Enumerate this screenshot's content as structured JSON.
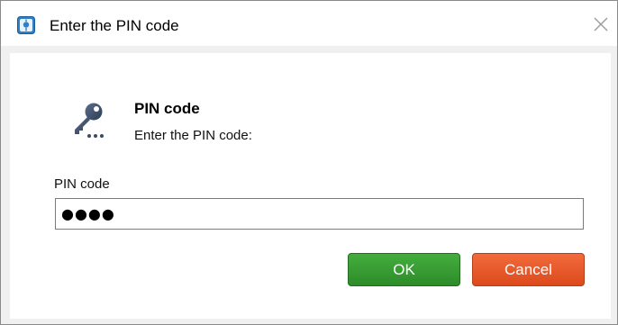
{
  "window": {
    "title": "Enter the PIN code",
    "app_icon": "app-logo-icon",
    "close_icon": "close-icon"
  },
  "header": {
    "icon": "key-icon",
    "title": "PIN code",
    "subtitle": "Enter the PIN code:"
  },
  "form": {
    "pin_label": "PIN code",
    "pin_value": "●●●●"
  },
  "buttons": {
    "ok_label": "OK",
    "cancel_label": "Cancel"
  },
  "colors": {
    "ok": "#35a02f",
    "cancel": "#e85a2a"
  }
}
